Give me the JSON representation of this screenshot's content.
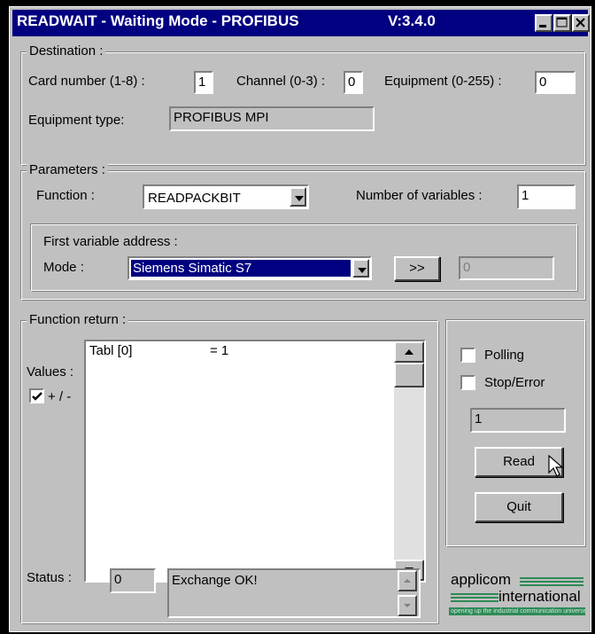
{
  "window": {
    "title": "READWAIT - Waiting Mode - PROFIBUS",
    "version": "V:3.4.0"
  },
  "destination": {
    "legend": "Destination :",
    "card_label": "Card number (1-8) :",
    "card_value": "1",
    "channel_label": "Channel (0-3) :",
    "channel_value": "0",
    "equipment_label": "Equipment (0-255) :",
    "equipment_value": "0",
    "type_label": "Equipment type:",
    "type_value": "PROFIBUS MPI"
  },
  "parameters": {
    "legend": "Parameters :",
    "function_label": "Function :",
    "function_value": "READPACKBIT",
    "numvars_label": "Number of variables :",
    "numvars_value": "1",
    "first_var_legend": "First variable address :",
    "mode_label": "Mode :",
    "mode_value": "Siemens Simatic S7",
    "more_button": ">>",
    "address_value": "0"
  },
  "function_return": {
    "legend": "Function return :",
    "values_label": "Values :",
    "sign_label": "+ / -",
    "sign_checked": true,
    "rows": [
      {
        "name": "Tabl [0]",
        "value": "= 1"
      }
    ],
    "status_label": "Status :",
    "status_code": "0",
    "status_message": "Exchange OK!"
  },
  "controls": {
    "polling_label": "Polling",
    "polling_checked": false,
    "stoperror_label": "Stop/Error",
    "stoperror_checked": false,
    "count_value": "1",
    "read_button": "Read",
    "quit_button": "Quit"
  },
  "logo": {
    "name_top": "applicom",
    "name_bottom": "international",
    "tagline": "opening up the industrial communication universe"
  },
  "colors": {
    "titlebar": "#000080",
    "face": "#c0c0c0",
    "logo_green": "#2e8b57"
  }
}
